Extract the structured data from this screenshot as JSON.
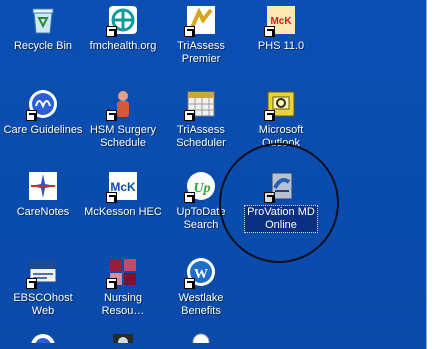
{
  "desktop": {
    "icons": [
      {
        "id": "recycle-bin",
        "label": "Recycle Bin",
        "icon": "recycle-bin-icon",
        "color": "#2e9bd6",
        "shortcut": false
      },
      {
        "id": "fmchealth",
        "label": "fmchealth.org",
        "icon": "fmchealth-logo-icon",
        "color": "#1a9a9a",
        "shortcut": true
      },
      {
        "id": "triassess-premier",
        "label": "TriAssess\nPremier",
        "icon": "triassess-premier-icon",
        "color": "#e6c13a",
        "shortcut": true
      },
      {
        "id": "phs",
        "label": "PHS 11.0",
        "icon": "mck-phs-icon",
        "color": "#e02121",
        "shortcut": true
      },
      {
        "id": "care-guidelines",
        "label": "Care Guidelines",
        "icon": "care-guidelines-icon",
        "color": "#2c5fd6",
        "shortcut": true
      },
      {
        "id": "hsm-surgery",
        "label": "HSM Surgery\nSchedule",
        "icon": "hsm-surgery-icon",
        "color": "#e07b5a",
        "shortcut": true
      },
      {
        "id": "triassess-scheduler",
        "label": "TriAssess\nScheduler",
        "icon": "calendar-icon",
        "color": "#d8d8d8",
        "shortcut": true
      },
      {
        "id": "microsoft-outlook",
        "label": "Microsoft\nOutlook",
        "icon": "outlook-icon",
        "color": "#e7d23a",
        "shortcut": true
      },
      {
        "id": "carenotes",
        "label": "CareNotes",
        "icon": "carenotes-icon",
        "color": "#2356c9",
        "shortcut": false
      },
      {
        "id": "mckesson-hec",
        "label": "McKesson HEC",
        "icon": "mck-hec-icon",
        "color": "#0b4fa0",
        "shortcut": true
      },
      {
        "id": "uptodate",
        "label": "UpToDate\nSearch",
        "icon": "uptodate-icon",
        "color": "#2aa541",
        "shortcut": true
      },
      {
        "id": "provation",
        "label": "ProVation MD\nOnline",
        "icon": "provation-icon",
        "color": "#3f74c8",
        "shortcut": true,
        "selected": true
      },
      {
        "id": "ebscohost",
        "label": "EBSCOhost\nWeb",
        "icon": "ebsco-icon",
        "color": "#1e4a8f",
        "shortcut": true
      },
      {
        "id": "nursing-resources",
        "label": "Nursing\nResou…",
        "icon": "nursing-resources-icon",
        "color": "#9b1d3c",
        "shortcut": true
      },
      {
        "id": "westlake-benefits",
        "label": "Westlake\nBenefits",
        "icon": "westlake-icon",
        "color": "#1d6ec8",
        "shortcut": true
      }
    ]
  }
}
